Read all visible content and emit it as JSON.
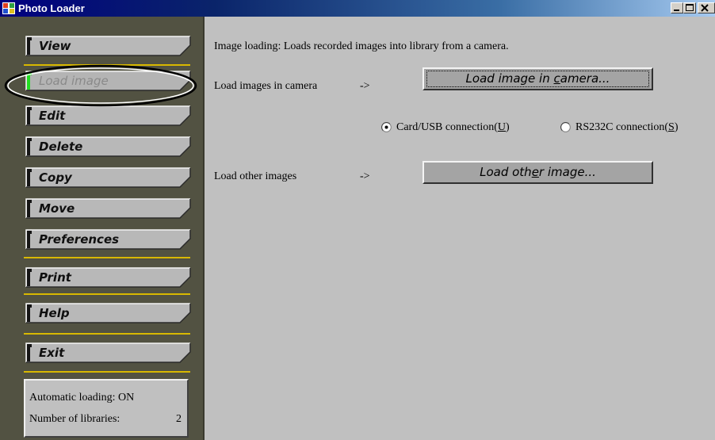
{
  "window": {
    "title": "Photo Loader",
    "controls": [
      "minimize",
      "maximize",
      "close"
    ]
  },
  "sidebar": {
    "items": [
      {
        "label": "View",
        "state": "normal"
      },
      {
        "label": "Load image",
        "state": "disabled-selected"
      },
      {
        "label": "Edit",
        "state": "normal"
      },
      {
        "label": "Delete",
        "state": "normal"
      },
      {
        "label": "Copy",
        "state": "normal"
      },
      {
        "label": "Move",
        "state": "normal"
      },
      {
        "label": "Preferences",
        "state": "normal"
      },
      {
        "label": "Print",
        "state": "normal"
      },
      {
        "label": "Help",
        "state": "normal"
      },
      {
        "label": "Exit",
        "state": "normal"
      }
    ],
    "status": {
      "auto_loading_label": "Automatic loading:",
      "auto_loading_value": "ON",
      "libraries_label": "Number of libraries:",
      "libraries_value": "2"
    }
  },
  "main": {
    "description": "Image loading: Loads recorded images into library from a camera.",
    "camera_row": {
      "label": "Load images in camera",
      "arrow": "->",
      "button_pre": "Load image in ",
      "button_underline": "c",
      "button_post": "amera..."
    },
    "connection": {
      "option1_pre": "Card/USB connection(",
      "option1_key": "U",
      "option1_post": ")",
      "option1_selected": true,
      "option2_pre": "RS232C connection(",
      "option2_key": "S",
      "option2_post": ")",
      "option2_selected": false
    },
    "other_row": {
      "label": "Load other images",
      "arrow": "->",
      "button_pre": "Load oth",
      "button_underline": "e",
      "button_post": "r image..."
    }
  },
  "colors": {
    "sidebar_bg": "#525242",
    "separator": "#d8b800",
    "button_face": "#a4a4a4",
    "window_bg": "#c0c0c0",
    "title_bar": "#0a246a"
  }
}
